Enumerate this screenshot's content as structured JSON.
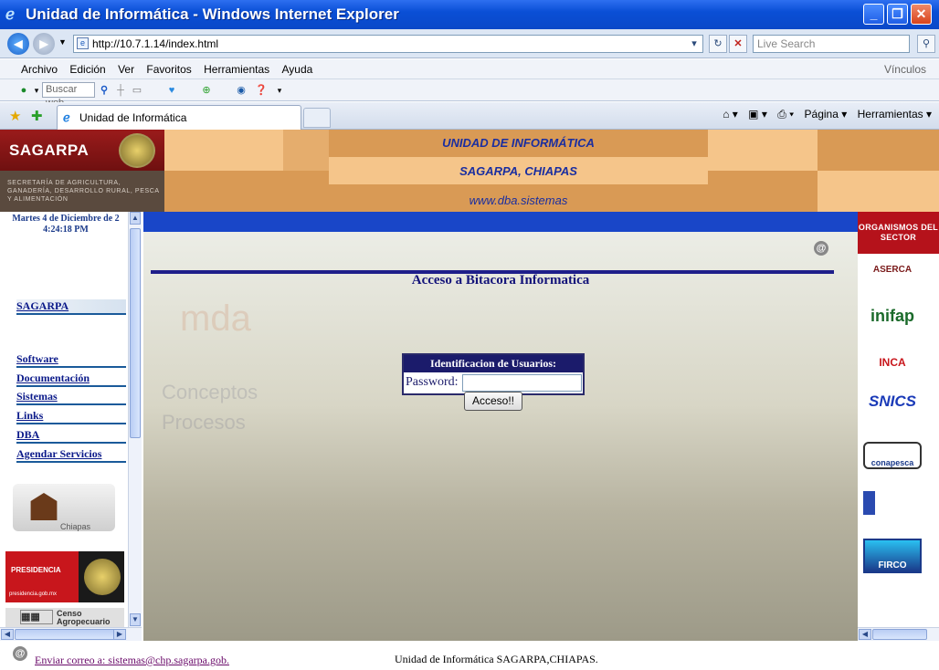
{
  "window": {
    "title": "Unidad de Informática - Windows Internet Explorer",
    "buttons": {
      "minimize": "_",
      "maximize": "❐",
      "close": "✕"
    }
  },
  "address_bar": {
    "url": "http://10.7.1.14/index.html",
    "search_placeholder": "Live Search"
  },
  "menu": {
    "items": [
      "Archivo",
      "Edición",
      "Ver",
      "Favoritos",
      "Herramientas",
      "Ayuda"
    ],
    "links_label": "Vínculos"
  },
  "toolbar": {
    "search_placeholder": "Buscar web"
  },
  "tabs": {
    "active_tab": "Unidad de Informática",
    "commands": [
      "Página ▾",
      "Herramientas ▾"
    ]
  },
  "site_header": {
    "brand": "SAGARPA",
    "brand_subtitle": "SECRETARÍA DE AGRICULTURA, GANADERÍA, DESARROLLO RURAL, PESCA Y ALIMENTACIÓN",
    "line1": "UNIDAD DE INFORMÁTICA",
    "line2": "SAGARPA, CHIAPAS",
    "line3": "www.dba.sistemas",
    "colors": {
      "band_light": "#f5c58a",
      "band_dark": "#d99a55",
      "brand_red": "#9a1b1b"
    }
  },
  "left_frame": {
    "clock_date": "Martes 4 de Diciembre de 2",
    "clock_time": "4:24:18 PM",
    "nav": [
      "SAGARPA",
      "Software",
      "Documentación",
      "Sistemas",
      "Links",
      "DBA",
      "Agendar Servicios"
    ],
    "banners": {
      "chiapas": "Chiapas",
      "presidencia": "PRESIDENCIA",
      "presidencia_url": "presidencia.gob.mx",
      "censo": "Censo Agropecuario"
    }
  },
  "main": {
    "heading": "Acceso a Bitacora Informatica",
    "login_title": "Identificacion de Usuarios:",
    "password_label": "Password:",
    "password_value": "",
    "submit_label": "Acceso!!",
    "bg_words": [
      "mda",
      "Conceptos",
      "Procesos"
    ]
  },
  "right_frame": {
    "header": "ORGANISMOS DEL SECTOR",
    "orgs": [
      "ASERCA",
      "inifap",
      "INCA",
      "SNICS",
      "conapesca",
      "",
      "FIRCO"
    ]
  },
  "footer": {
    "email_link": "Enviar correo a: sistemas@chp.sagarpa.gob.",
    "text": "Unidad de Informática SAGARPA,CHIAPAS."
  }
}
